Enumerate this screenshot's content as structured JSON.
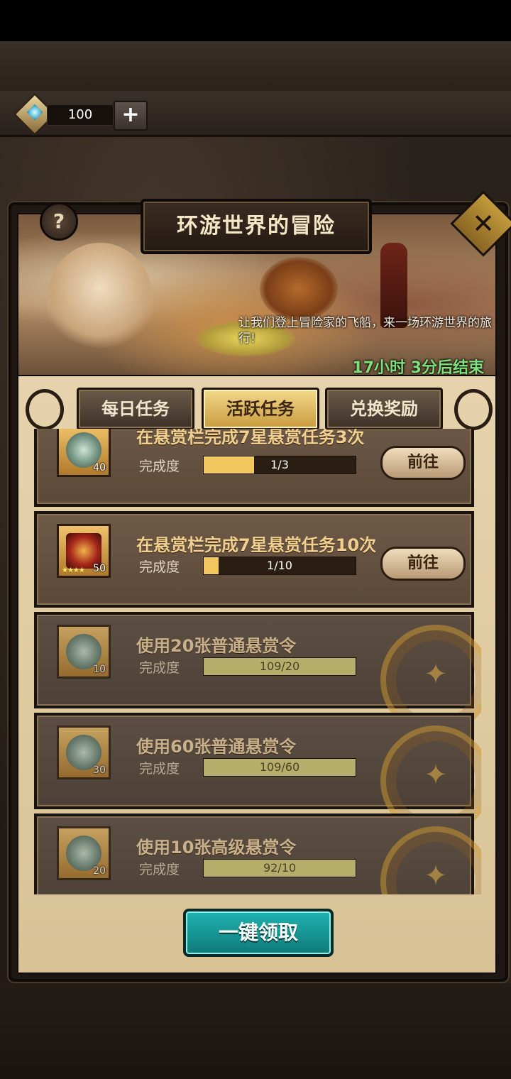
{
  "currency": {
    "gem_count": "100",
    "add_label": "+"
  },
  "event": {
    "title": "环游世界的冒险",
    "help_label": "?",
    "close_label": "✕",
    "description": "让我们登上冒险家的飞船，来一场环游世界的旅行!",
    "timer": "17小时 3分后结束"
  },
  "tabs": [
    {
      "label": "每日任务"
    },
    {
      "label": "活跃任务"
    },
    {
      "label": "兑换奖励"
    }
  ],
  "tasks": [
    {
      "title": "在悬赏栏完成7星悬赏任务3次",
      "progress_label": "完成度",
      "progress_text": "1/3",
      "progress": 0.333,
      "reward_count": "40",
      "action": "前往"
    },
    {
      "title": "在悬赏栏完成7星悬赏任务10次",
      "progress_label": "完成度",
      "progress_text": "1/10",
      "progress": 0.1,
      "reward_count": "50",
      "stars": "★★★★",
      "action": "前往"
    },
    {
      "title": "使用20张普通悬赏令",
      "progress_label": "完成度",
      "progress_text": "109/20",
      "progress": 1.0,
      "reward_count": "10"
    },
    {
      "title": "使用60张普通悬赏令",
      "progress_label": "完成度",
      "progress_text": "109/60",
      "progress": 1.0,
      "reward_count": "30"
    },
    {
      "title": "使用10张高级悬赏令",
      "progress_label": "完成度",
      "progress_text": "92/10",
      "progress": 1.0,
      "reward_count": "20"
    }
  ],
  "claim_all_label": "一键领取",
  "colors": {
    "accent_gold": "#f2c85e",
    "claim_teal": "#1fb2b0",
    "timer_green": "#7ee07a"
  }
}
